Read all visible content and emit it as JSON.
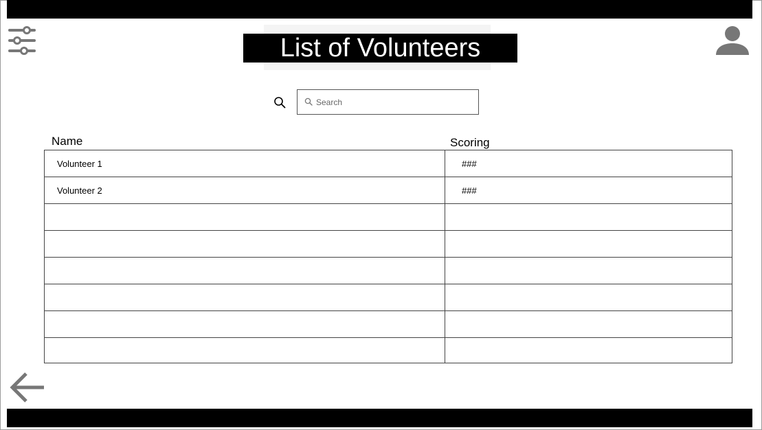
{
  "title": "List of Volunteers",
  "search": {
    "placeholder": "Search"
  },
  "table": {
    "columns": [
      "Name",
      "Scoring"
    ],
    "rows": [
      {
        "name": "Volunteer 1",
        "score": "###"
      },
      {
        "name": "Volunteer 2",
        "score": "###"
      },
      {
        "name": "",
        "score": ""
      },
      {
        "name": "",
        "score": ""
      },
      {
        "name": "",
        "score": ""
      },
      {
        "name": "",
        "score": ""
      },
      {
        "name": "",
        "score": ""
      },
      {
        "name": "",
        "score": ""
      }
    ]
  },
  "icons": {
    "filter": "sliders-icon",
    "profile": "user-icon",
    "back": "arrow-left-icon",
    "search": "search-icon"
  },
  "colors": {
    "bars": "#000000",
    "icon_gray": "#777777"
  }
}
